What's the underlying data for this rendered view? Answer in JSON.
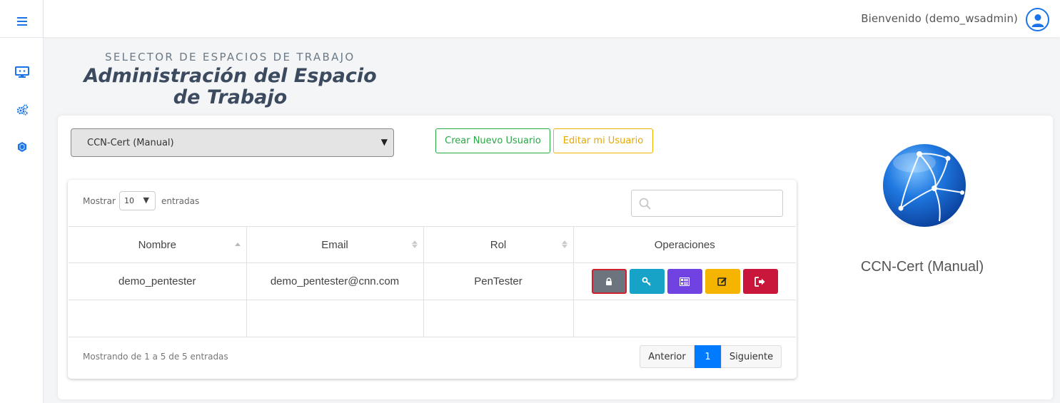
{
  "topbar": {
    "welcome": "Bienvenido (demo_wsadmin)"
  },
  "sidebar": {
    "items": [
      {
        "icon": "hamburger-menu-icon"
      },
      {
        "icon": "monitor-icon"
      },
      {
        "icon": "gears-icon"
      },
      {
        "icon": "hexagon-icon"
      }
    ]
  },
  "header": {
    "subtitle": "SELECTOR DE ESPACIOS DE TRABAJO",
    "title": "Administración del Espacio de Trabajo"
  },
  "workspace_select": {
    "value": "CCN-Cert (Manual)"
  },
  "actions": {
    "create_user": "Crear Nuevo Usuario",
    "edit_me": "Editar mi Usuario"
  },
  "table": {
    "show_label": "Mostrar",
    "page_length": "10",
    "entries_label": "entradas",
    "columns": [
      "Nombre",
      "Email",
      "Rol",
      "Operaciones"
    ],
    "rows": [
      {
        "nombre": "demo_pentester",
        "email": "demo_pentester@cnn.com",
        "rol": "PenTester"
      }
    ],
    "info": "Mostrando de 1 a 5 de 5 entradas",
    "pager": {
      "prev": "Anterior",
      "current": "1",
      "next": "Siguiente"
    }
  },
  "side_panel": {
    "workspace_name": "CCN-Cert (Manual)"
  },
  "colors": {
    "accent": "#007bff",
    "lock": "#6c757d",
    "key": "#17a2c8",
    "qr": "#6f42e1",
    "edit": "#f5b400",
    "exit": "#c8173a"
  }
}
